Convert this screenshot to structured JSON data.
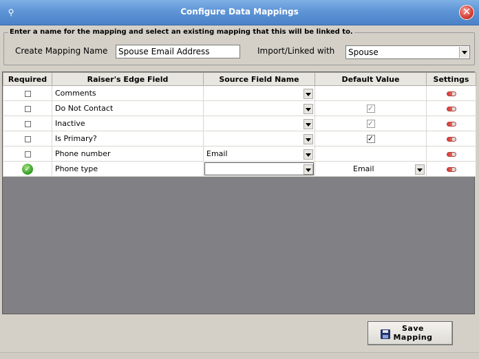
{
  "window": {
    "title": "Configure  Data Mappings",
    "pin_icon": "map-pin-icon",
    "close_icon": "close-icon"
  },
  "mapping_group": {
    "legend": "Enter a name for the mapping and select an existing mapping that this will be linked to.",
    "name_label": "Create Mapping Name",
    "name_value": "Spouse Email Address",
    "linked_label": "Import/Linked with",
    "linked_value": "Spouse"
  },
  "grid": {
    "headers": [
      "Required",
      "Raiser's Edge Field",
      "Source Field Name",
      "Default Value",
      "Settings"
    ],
    "rows": [
      {
        "required": "checkbox",
        "field": "Comments",
        "source": "",
        "default": "",
        "default_type": "text"
      },
      {
        "required": "checkbox",
        "field": "Do Not Contact",
        "source": "",
        "default": "✓",
        "default_type": "checkbox-dim"
      },
      {
        "required": "checkbox",
        "field": "Inactive",
        "source": "",
        "default": "✓",
        "default_type": "checkbox-dim"
      },
      {
        "required": "checkbox",
        "field": "Is Primary?",
        "source": "",
        "default": "✓",
        "default_type": "checkbox-dark"
      },
      {
        "required": "checkbox",
        "field": "Phone number",
        "source": "Email",
        "default": "",
        "default_type": "text"
      },
      {
        "required": "check-icon",
        "field": "Phone type",
        "source": "",
        "default": "Email",
        "default_type": "combo"
      }
    ]
  },
  "save_button": {
    "line1": "Save",
    "line2": "Mapping",
    "icon": "floppy-disk-icon"
  }
}
